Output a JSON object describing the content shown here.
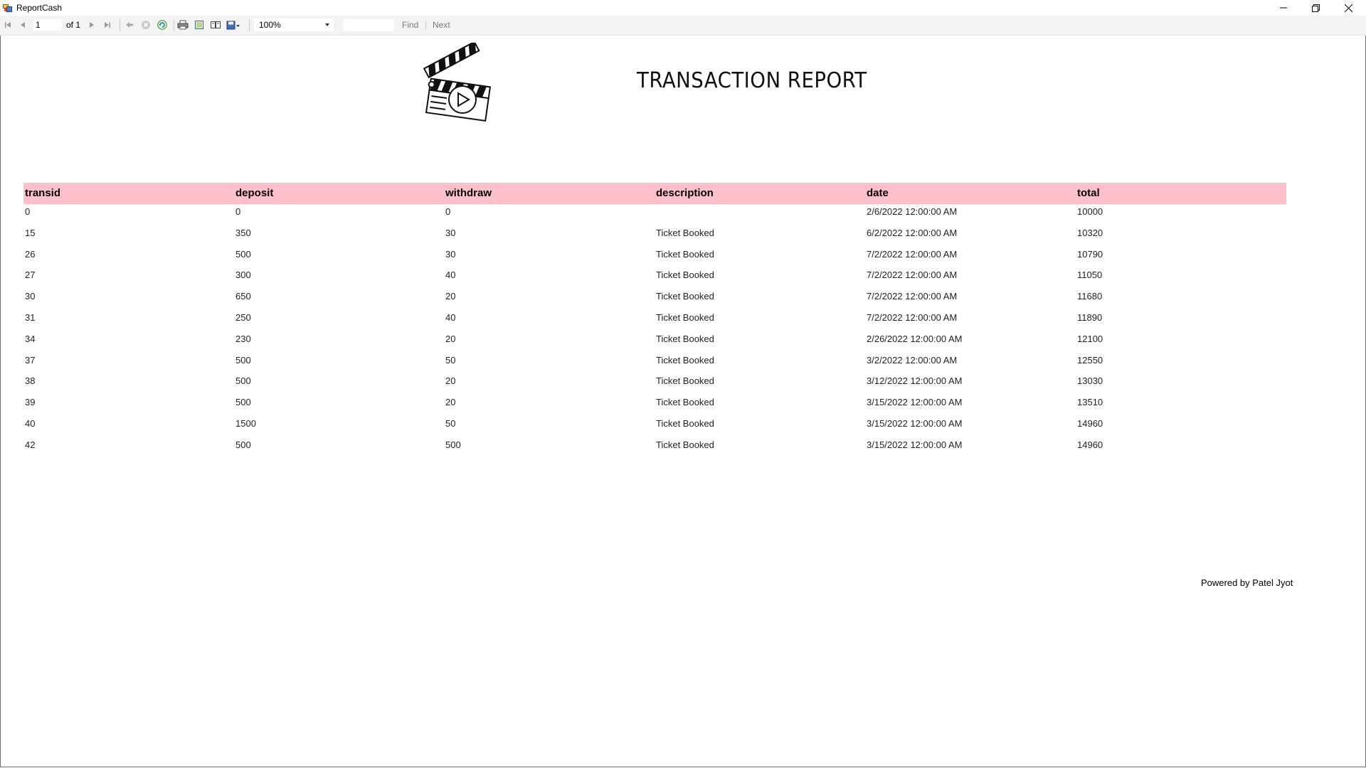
{
  "window": {
    "title": "ReportCash"
  },
  "toolbar": {
    "page_current": "1",
    "page_of": "of  1",
    "zoom": "100%",
    "find_label": "Find",
    "next_label": "Next"
  },
  "report": {
    "title": "TRANSACTION REPORT",
    "footer": "Powered by Patel Jyot",
    "header_color": "#ffc0cb",
    "columns": [
      "transid",
      "deposit",
      "withdraw",
      "description",
      "date",
      "total"
    ],
    "rows": [
      [
        "0",
        "0",
        "0",
        "",
        "2/6/2022 12:00:00 AM",
        "10000"
      ],
      [
        "15",
        "350",
        "30",
        "Ticket Booked",
        "6/2/2022 12:00:00 AM",
        "10320"
      ],
      [
        "26",
        "500",
        "30",
        "Ticket Booked",
        "7/2/2022 12:00:00 AM",
        "10790"
      ],
      [
        "27",
        "300",
        "40",
        "Ticket Booked",
        "7/2/2022 12:00:00 AM",
        "11050"
      ],
      [
        "30",
        "650",
        "20",
        "Ticket Booked",
        "7/2/2022 12:00:00 AM",
        "11680"
      ],
      [
        "31",
        "250",
        "40",
        "Ticket Booked",
        "7/2/2022 12:00:00 AM",
        "11890"
      ],
      [
        "34",
        "230",
        "20",
        "Ticket Booked",
        "2/26/2022 12:00:00 AM",
        "12100"
      ],
      [
        "37",
        "500",
        "50",
        "Ticket Booked",
        "3/2/2022 12:00:00 AM",
        "12550"
      ],
      [
        "38",
        "500",
        "20",
        "Ticket Booked",
        "3/12/2022 12:00:00 AM",
        "13030"
      ],
      [
        "39",
        "500",
        "20",
        "Ticket Booked",
        "3/15/2022 12:00:00 AM",
        "13510"
      ],
      [
        "40",
        "1500",
        "50",
        "Ticket Booked",
        "3/15/2022 12:00:00 AM",
        "14960"
      ],
      [
        "42",
        "500",
        "500",
        "Ticket Booked",
        "3/15/2022 12:00:00 AM",
        "14960"
      ]
    ]
  }
}
